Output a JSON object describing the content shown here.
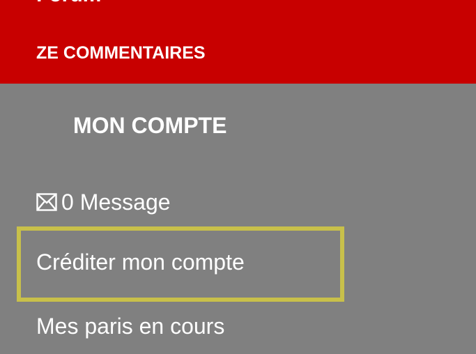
{
  "menu": {
    "cut_item_label": "Forum",
    "ze_commentaires_label": "ZE COMMENTAIRES",
    "account_section_title": "MON COMPTE",
    "message_count_label": "0 Message",
    "credit_account_label": "Créditer mon compte",
    "current_bets_label": "Mes paris en cours"
  },
  "icons": {
    "message": "envelope-icon"
  },
  "colors": {
    "top_background": "#c80000",
    "panel_background": "#808080",
    "text": "#ffffff",
    "highlight": "#c8c04a"
  }
}
